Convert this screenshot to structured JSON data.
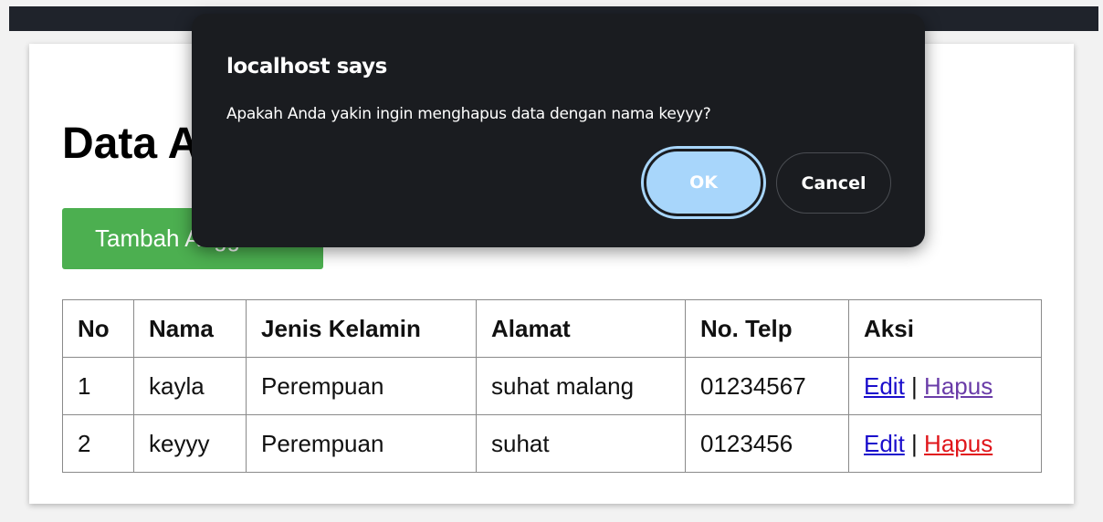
{
  "page": {
    "title": "Data Anggota",
    "add_button_label": "Tambah Anggota"
  },
  "table": {
    "headers": [
      "No",
      "Nama",
      "Jenis Kelamin",
      "Alamat",
      "No. Telp",
      "Aksi"
    ],
    "rows": [
      {
        "no": "1",
        "nama": "kayla",
        "jenis_kelamin": "Perempuan",
        "alamat": "suhat malang",
        "telp": "01234567",
        "edit": "Edit",
        "separator": "|",
        "hapus": "Hapus"
      },
      {
        "no": "2",
        "nama": "keyyy",
        "jenis_kelamin": "Perempuan",
        "alamat": "suhat",
        "telp": "0123456",
        "edit": "Edit",
        "separator": "|",
        "hapus": "Hapus"
      }
    ]
  },
  "dialog": {
    "title": "localhost says",
    "message": "Apakah Anda yakin ingin menghapus data dengan nama keyyy?",
    "ok_label": "OK",
    "cancel_label": "Cancel"
  },
  "colors": {
    "add_button": "#4caf50",
    "dialog_bg": "#1a1c20",
    "ok_button": "#a8d6fb",
    "link": "#1a0dcc",
    "link_visited": "#6a3ca8",
    "link_active": "#e0161b"
  }
}
